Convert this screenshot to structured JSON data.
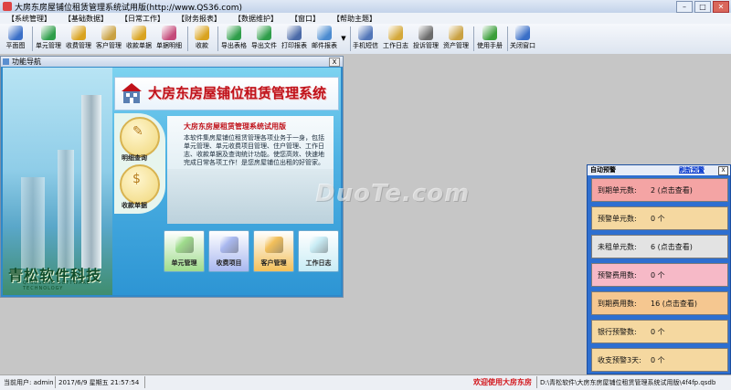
{
  "window": {
    "title": "大房东房屋铺位租赁管理系统试用版(http://www.QS36.com)"
  },
  "menubar": [
    "【系统管理】",
    "【基础数据】",
    "【日常工作】",
    "【财务报表】",
    "【数据维护】",
    "【窗口】",
    "【帮助主题】"
  ],
  "toolbar": [
    {
      "label": "平面图",
      "icon": "floorplan-icon",
      "color": "#3a6fc7"
    },
    {
      "label": "单元管理",
      "icon": "unit-icon",
      "color": "#2f9e4a"
    },
    {
      "label": "收费管理",
      "icon": "coins-icon",
      "color": "#d9a320"
    },
    {
      "label": "客户管理",
      "icon": "customer-icon",
      "color": "#c9a142"
    },
    {
      "label": "收款单据",
      "icon": "receipt-icon",
      "color": "#d9a320"
    },
    {
      "label": "单据明细",
      "icon": "details-icon",
      "color": "#c44a7a"
    },
    {
      "label": "收款",
      "icon": "payment-icon",
      "color": "#d9a320"
    },
    {
      "label": "导出表格",
      "icon": "export-table-icon",
      "color": "#2f9e4a"
    },
    {
      "label": "导出文件",
      "icon": "export-file-icon",
      "color": "#2f9e4a"
    },
    {
      "label": "打印报表",
      "icon": "print-icon",
      "color": "#4b6aa8"
    },
    {
      "label": "邮件报表",
      "icon": "mail-icon",
      "color": "#4b8bd0"
    },
    {
      "label": "手机短信",
      "icon": "phone-icon",
      "color": "#5276b8"
    },
    {
      "label": "工作日志",
      "icon": "log-icon",
      "color": "#d4a83a"
    },
    {
      "label": "投诉管理",
      "icon": "complaint-icon",
      "color": "#6b6b6b"
    },
    {
      "label": "资产管理",
      "icon": "asset-icon",
      "color": "#c9a142"
    },
    {
      "label": "使用手册",
      "icon": "help-icon",
      "color": "#3a9e3a"
    },
    {
      "label": "关闭窗口",
      "icon": "close-window-icon",
      "color": "#3a6fc7"
    }
  ],
  "nav_window": {
    "title": "功能导航",
    "close": "X",
    "system_title": "大房东房屋铺位租赁管理系统",
    "info_heading": "大房东房屋租赁管理系统试用版",
    "info_text": "本软件集房屋铺位租赁管理各项业务于一身，包括单元管理、单元收费项目管理、住户管理、工作日志、收款单据及查询统计功能。使您高效、快速地完成日常各项工作！是您房屋铺位出租的好管家。",
    "left_buttons": [
      "明细查询",
      "收款单据"
    ],
    "bottom_buttons": [
      {
        "label": "单元管理",
        "icon": "house-icon",
        "color": "#9fdc8c"
      },
      {
        "label": "收费项目",
        "icon": "fee-icon",
        "color": "#a9b8f0"
      },
      {
        "label": "客户管理",
        "icon": "people-icon",
        "color": "#f3c05a"
      },
      {
        "label": "工作日志",
        "icon": "notebook-icon",
        "color": "#c9ecf5"
      }
    ],
    "brand": "青松软件科技",
    "brand_sub": "QINGSONG SOFTWARE TECHNOLOGY"
  },
  "watermark": "DuoTe.com",
  "alert_panel": {
    "title": "自动预警",
    "refresh": "刷新预警",
    "close": "X",
    "rows": [
      {
        "label": "到期单元数:",
        "value": "2 (点击查看)",
        "color": "#f4a4a4"
      },
      {
        "label": "预警单元数:",
        "value": "0 个",
        "color": "#f5d8a0"
      },
      {
        "label": "未租单元数:",
        "value": "6 (点击查看)",
        "color": "#e3e3e3"
      },
      {
        "label": "预警费用数:",
        "value": "0 个",
        "color": "#f6b9c7"
      },
      {
        "label": "到期费用数:",
        "value": "16 (点击查看)",
        "color": "#f5c790"
      },
      {
        "label": "银行预警数:",
        "value": "0 个",
        "color": "#f5d8a0"
      },
      {
        "label": "收支预警3天:",
        "value": "0 个",
        "color": "#f5d8a0"
      }
    ]
  },
  "statusbar": {
    "user": "当前用户: admin",
    "datetime": "2017/6/9 星期五 21:57:54",
    "welcome": "欢迎使用大房东房",
    "path": "D:\\青松软件\\大房东房屋铺位租赁管理系统试用版\\4f4fp.qsdb"
  }
}
